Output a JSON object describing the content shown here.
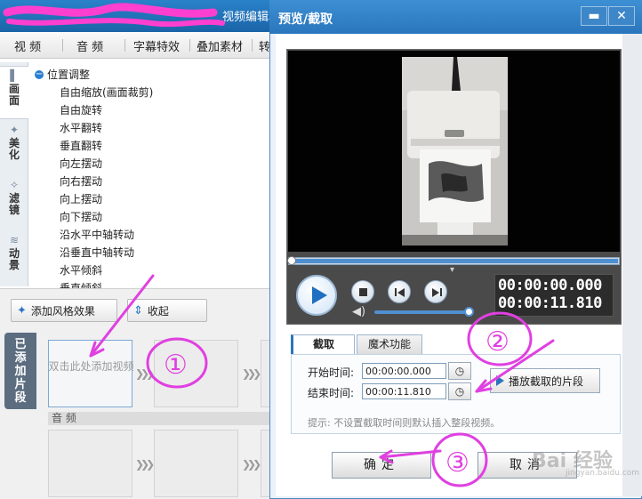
{
  "app": {
    "title": "视频编辑软件",
    "menu": [
      "视 频",
      "音 频",
      "字幕特效",
      "叠加素材",
      "转"
    ]
  },
  "side_tabs": [
    {
      "label": "画面",
      "icon": "picture-icon"
    },
    {
      "label": "美化",
      "icon": "sparkle-icon"
    },
    {
      "label": "滤镜",
      "icon": "wand-icon"
    },
    {
      "label": "动景",
      "icon": "wave-icon"
    }
  ],
  "effects": {
    "group_title": "位置调整",
    "items": [
      "自由缩放(画面裁剪)",
      "自由旋转",
      "水平翻转",
      "垂直翻转",
      "向左摆动",
      "向右摆动",
      "向上摆动",
      "向下摆动",
      "沿水平中轴转动",
      "沿垂直中轴转动",
      "水平倾斜",
      "垂直倾斜"
    ]
  },
  "toolbar": {
    "add_style_label": "添加风格效果",
    "collapse_label": "收起"
  },
  "clips": {
    "added_tab_label": "已添加片段",
    "add_video_label": "双击此处添加视频",
    "audio_label": "音 频"
  },
  "dialog": {
    "title": "预览/截取",
    "minimize_glyph": "▬",
    "close_glyph": "✕",
    "current_time": "00:00:00.000",
    "total_time": "00:00:11.810",
    "playback_progress": 0,
    "volume_level": 1.0,
    "tabs": [
      "截取",
      "魔术功能"
    ],
    "start_label": "开始时间:",
    "start_value": "00:00:00.000",
    "end_label": "结束时间:",
    "end_value": "00:00:11.810",
    "play_clip_label": "播放截取的片段",
    "hint": "提示: 不设置截取时间则默认插入整段视频。",
    "ok_label": "确定",
    "cancel_label": "取消"
  },
  "annotations": [
    "①",
    "②",
    "③"
  ],
  "watermark": "Bai 经验",
  "watermark_sub": "jingyan.baidu.com",
  "colors": {
    "title_bar": "#2a76bd",
    "annotation": "#e040e0",
    "accent": "#4f8fd0"
  }
}
